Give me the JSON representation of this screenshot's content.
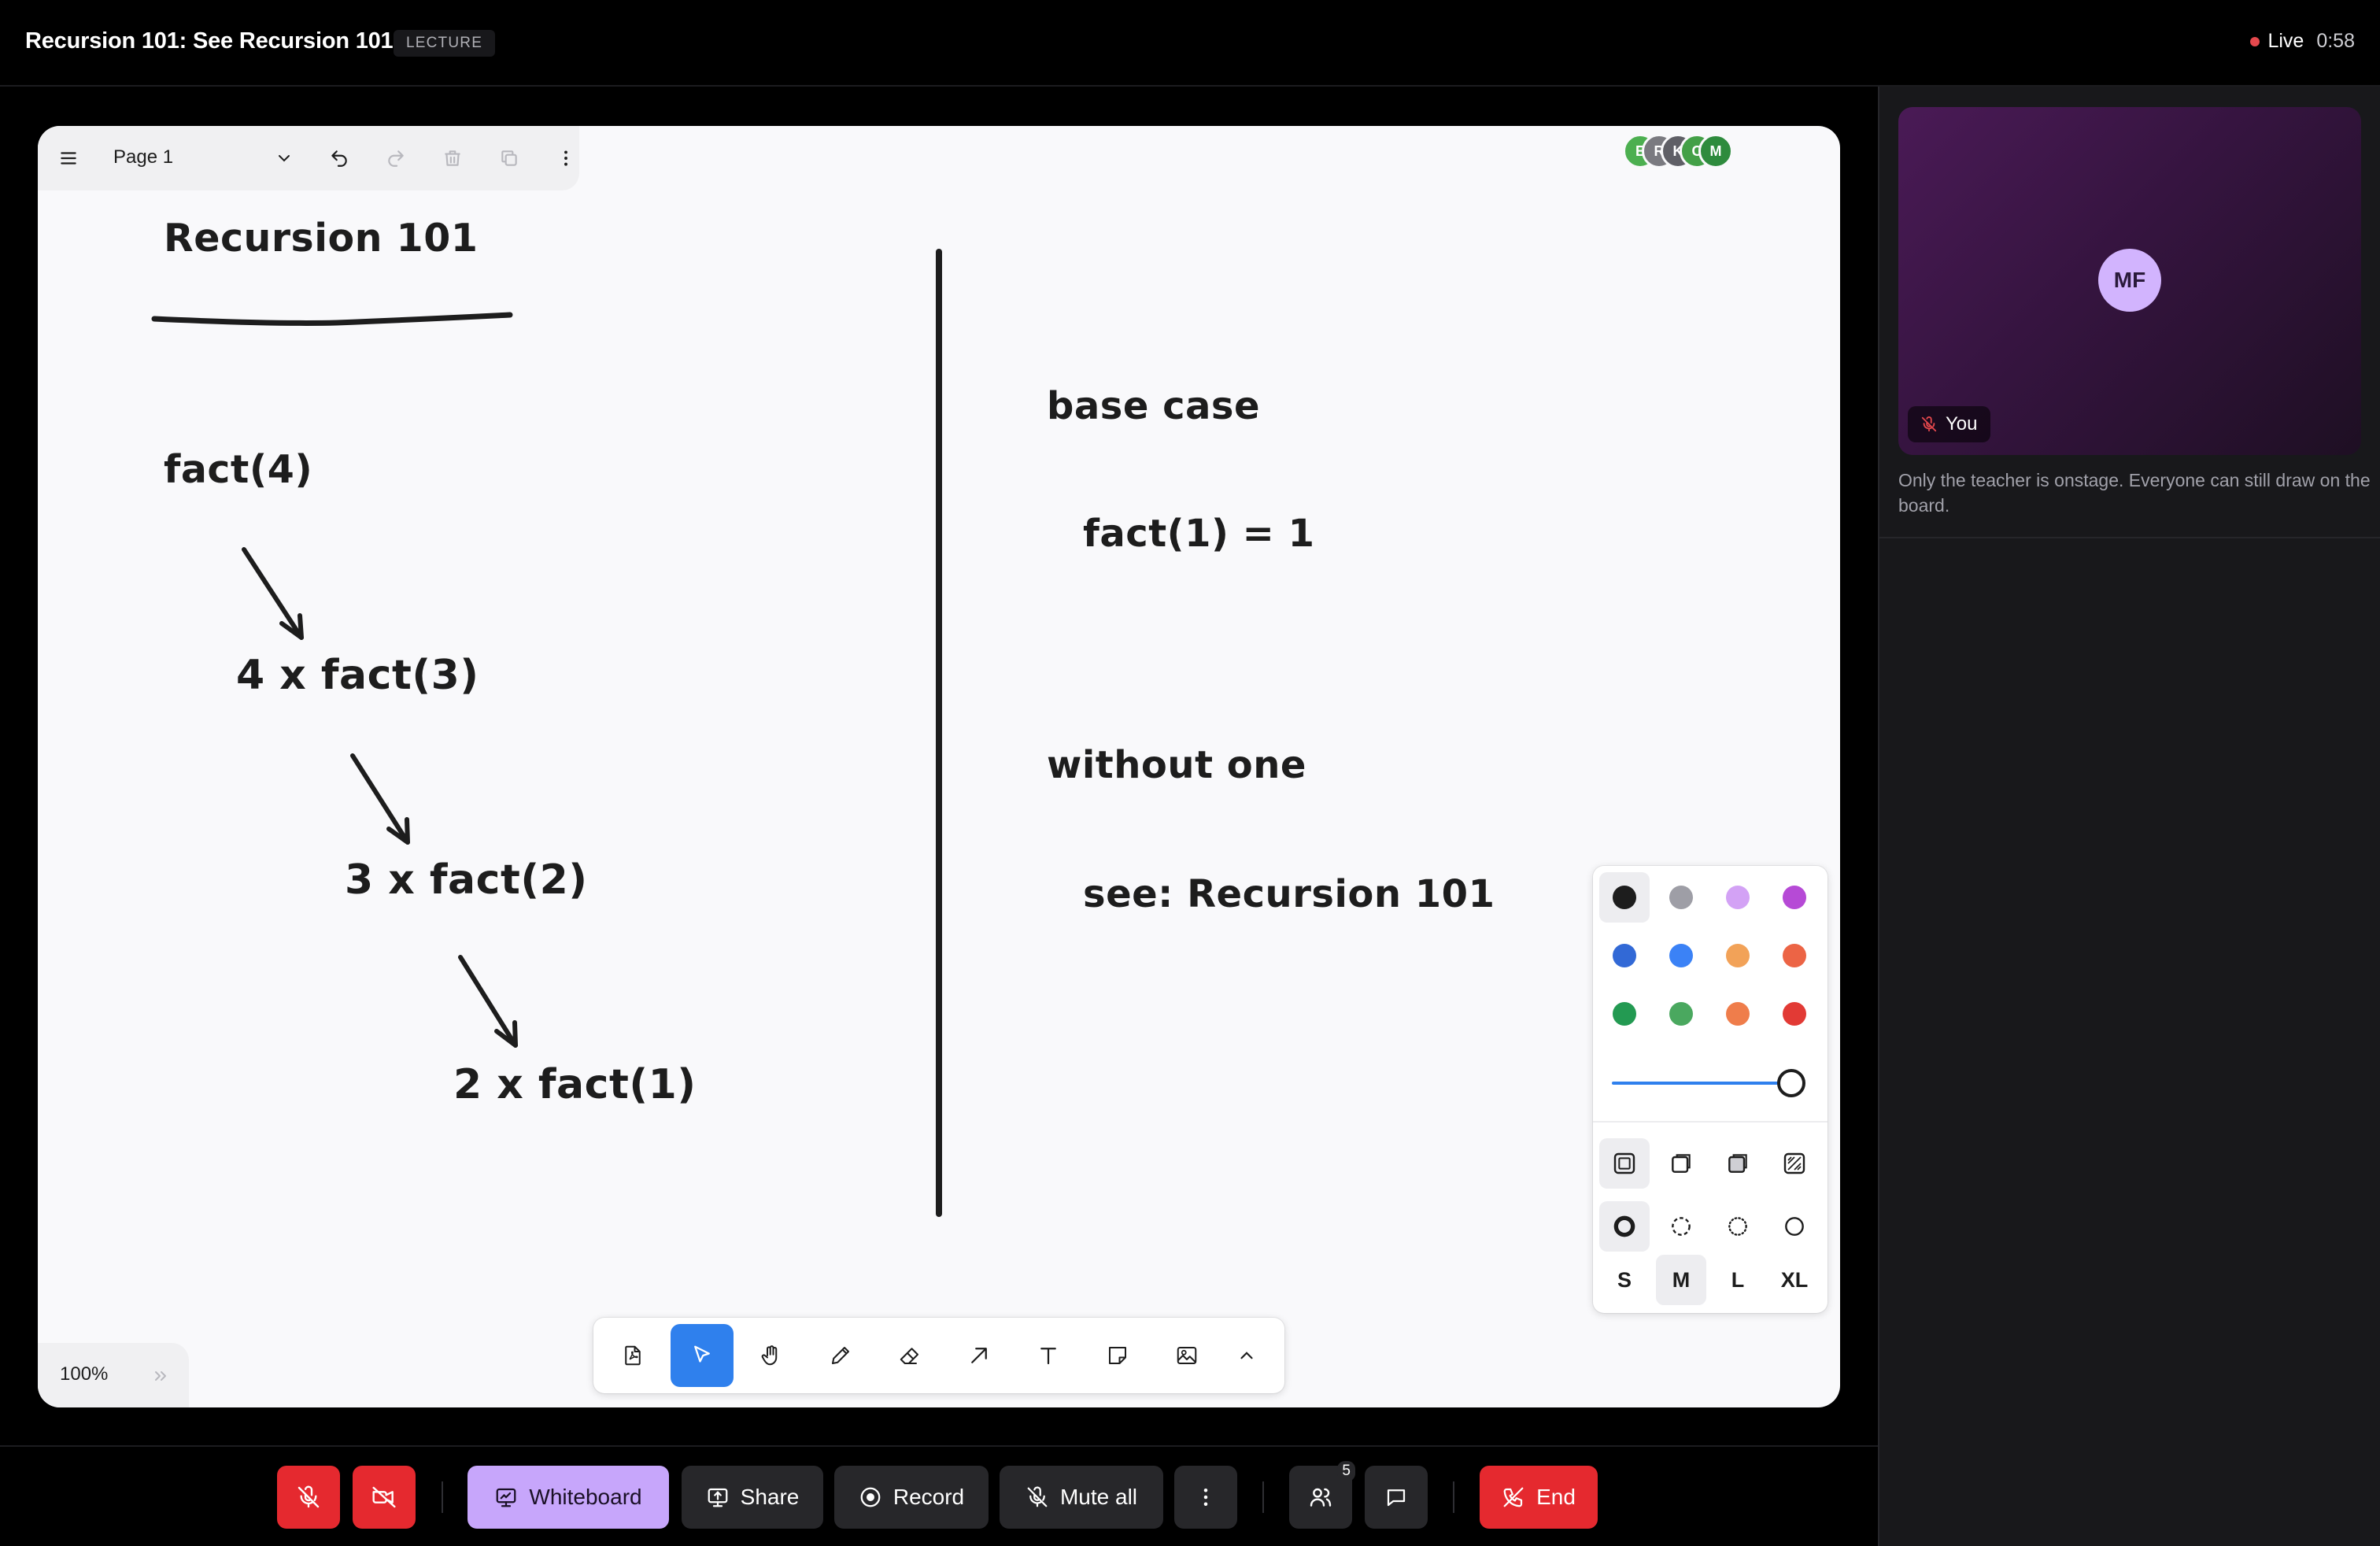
{
  "header": {
    "title": "Recursion 101: See Recursion 101",
    "badge": "LECTURE",
    "live_label": "Live",
    "timer": "0:58"
  },
  "whiteboard": {
    "page_name": "Page 1",
    "zoom": "100%",
    "participants": [
      "E",
      "R",
      "K",
      "C",
      "M"
    ],
    "participant_colors": [
      "#4caf50",
      "#7a7a80",
      "#5f5f66",
      "#43a047",
      "#2e8b3d"
    ],
    "canvas_text": {
      "title": "Recursion 101",
      "fact4": "fact(4)",
      "line1": "4 x fact(3)",
      "line2": "3 x fact(2)",
      "line3": "2 x fact(1)",
      "base_case": "base case",
      "fact1": "fact(1) = 1",
      "without_one": "without one",
      "see": "see: Recursion 101"
    },
    "toolbar_icons": [
      "pdf-icon",
      "select-icon",
      "hand-icon",
      "pencil-icon",
      "eraser-icon",
      "arrow-icon",
      "text-icon",
      "sticky-note-icon",
      "image-icon",
      "chevron-up-icon"
    ],
    "active_tool": "select",
    "style_panel": {
      "colors": [
        "#1d1d1d",
        "#9e9ea6",
        "#d3a2f5",
        "#b64ad6",
        "#3269d6",
        "#3b82f6",
        "#f2a258",
        "#ec6445",
        "#239a52",
        "#4aa85f",
        "#ef7d4b",
        "#e23a35"
      ],
      "selected_color": "#1d1d1d",
      "opacity_percent": 100,
      "sizes": [
        "S",
        "M",
        "L",
        "XL"
      ],
      "selected_size": "M"
    }
  },
  "sidebar": {
    "avatar_initials": "MF",
    "you_label": "You",
    "note": "Only the teacher is onstage. Everyone can still draw on the board."
  },
  "controls": {
    "whiteboard_label": "Whiteboard",
    "share_label": "Share",
    "record_label": "Record",
    "mute_all_label": "Mute all",
    "participants_count": "5",
    "end_label": "End"
  }
}
